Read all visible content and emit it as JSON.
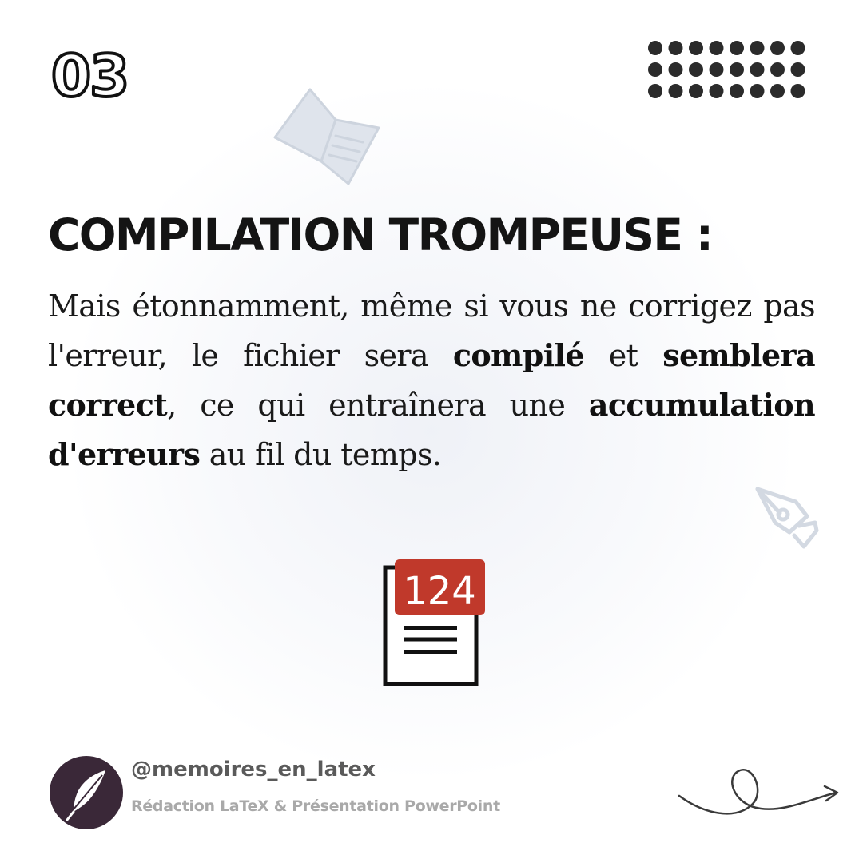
{
  "slide": {
    "number": "03"
  },
  "headline": "COMPILATION TROMPEUSE :",
  "body": {
    "t1": "Mais étonnamment, même si vous ne corrigez pas l'erreur, le fichier sera ",
    "b1": "compilé",
    "t2": " et ",
    "b2": "semblera correct",
    "t3": ", ce qui entraînera une ",
    "b3": "accumulation d'erreurs",
    "t4": " au fil du temps."
  },
  "document_badge": {
    "count": "124",
    "color": "#c0392b"
  },
  "footer": {
    "handle": "@memoires_en_latex",
    "tagline": "Rédaction LaTeX & Présentation PowerPoint"
  },
  "icons": {
    "slide_number": "outlined-digits",
    "dots": "dot-grid-decoration",
    "book": "open-book-icon",
    "pen": "fountain-pen-nib-icon",
    "document": "document-with-notification-badge",
    "avatar": "feather-quill-icon",
    "arrow": "curly-arrow-icon"
  },
  "colors": {
    "text": "#141414",
    "badge": "#c0392b",
    "avatar_bg": "#3a2838",
    "muted": "#a9a9a9",
    "decor": "#d8dde6"
  }
}
